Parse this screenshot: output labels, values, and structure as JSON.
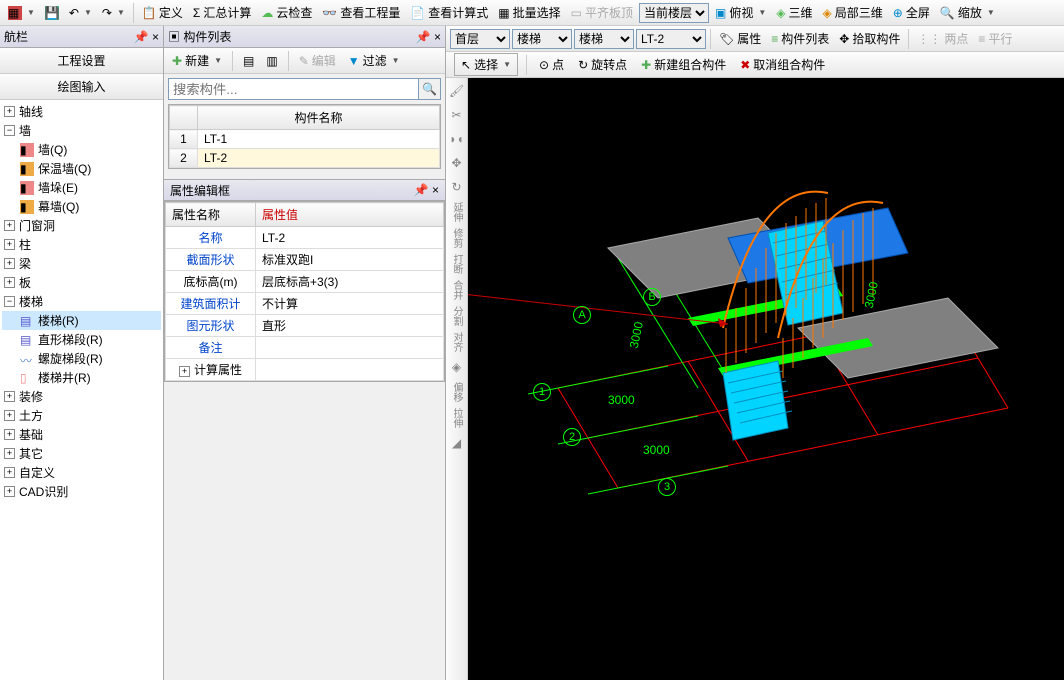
{
  "topToolbar": {
    "define": "定义",
    "sumCalc": "汇总计算",
    "cloudCheck": "云检查",
    "viewQty": "查看工程量",
    "viewCalc": "查看计算式",
    "batchSelect": "批量选择",
    "flatSlab": "平齐板顶",
    "currentFloor": "当前楼层",
    "top": "俯视",
    "threeD": "三维",
    "local3D": "局部三维",
    "fullScreen": "全屏",
    "zoom": "缩放"
  },
  "navPanel": {
    "title": "航栏",
    "tab1": "工程设置",
    "tab2": "绘图输入"
  },
  "tree": {
    "axis": "轴线",
    "wall": "墙",
    "wall_q": "墙(Q)",
    "insulation_q": "保温墙(Q)",
    "wallrib_e": "墙垛(E)",
    "curtain_q": "幕墙(Q)",
    "doorWindow": "门窗洞",
    "column": "柱",
    "beam": "梁",
    "slab": "板",
    "stair": "楼梯",
    "stair_r": "楼梯(R)",
    "straightStair_r": "直形梯段(R)",
    "spiralStair_r": "螺旋梯段(R)",
    "stairWell_r": "楼梯井(R)",
    "decoration": "装修",
    "earthwork": "土方",
    "foundation": "基础",
    "other": "其它",
    "custom": "自定义",
    "cad": "CAD识别"
  },
  "componentList": {
    "title": "构件列表",
    "new": "新建",
    "edit": "编辑",
    "filter": "过滤",
    "searchPlaceholder": "搜索构件...",
    "header": "构件名称",
    "rows": [
      "LT-1",
      "LT-2"
    ]
  },
  "propEditor": {
    "title": "属性编辑框",
    "colName": "属性名称",
    "colValue": "属性值",
    "rows": [
      {
        "name": "名称",
        "value": "LT-2",
        "blue": true
      },
      {
        "name": "截面形状",
        "value": "标准双跑I",
        "blue": true
      },
      {
        "name": "底标高(m)",
        "value": "层底标高+3(3)",
        "blue": false,
        "highlighted": true
      },
      {
        "name": "建筑面积计",
        "value": "不计算",
        "blue": true
      },
      {
        "name": "图元形状",
        "value": "直形",
        "blue": true
      },
      {
        "name": "备注",
        "value": "",
        "blue": true
      },
      {
        "name": "计算属性",
        "value": "",
        "blue": false,
        "expandable": true
      }
    ]
  },
  "rightToolbar1": {
    "floor": "首层",
    "cat1": "楼梯",
    "cat2": "楼梯",
    "component": "LT-2",
    "attributes": "属性",
    "compList": "构件列表",
    "pick": "拾取构件",
    "twoPoint": "两点",
    "parallel": "平行"
  },
  "rightToolbar2": {
    "select": "选择",
    "point": "点",
    "rotatePoint": "旋转点",
    "newGroup": "新建组合构件",
    "cancelGroup": "取消组合构件"
  },
  "sideTools": {
    "extend": "延伸",
    "trim": "修剪",
    "break": "打断",
    "merge": "合并",
    "split": "分割",
    "align": "对齐",
    "offset": "偏移",
    "stretch": "拉伸"
  },
  "viewport": {
    "dims": [
      "3000",
      "3000",
      "3000",
      "3000"
    ],
    "axes_letter": [
      "A",
      "B"
    ],
    "axes_num": [
      "1",
      "2",
      "3"
    ]
  }
}
